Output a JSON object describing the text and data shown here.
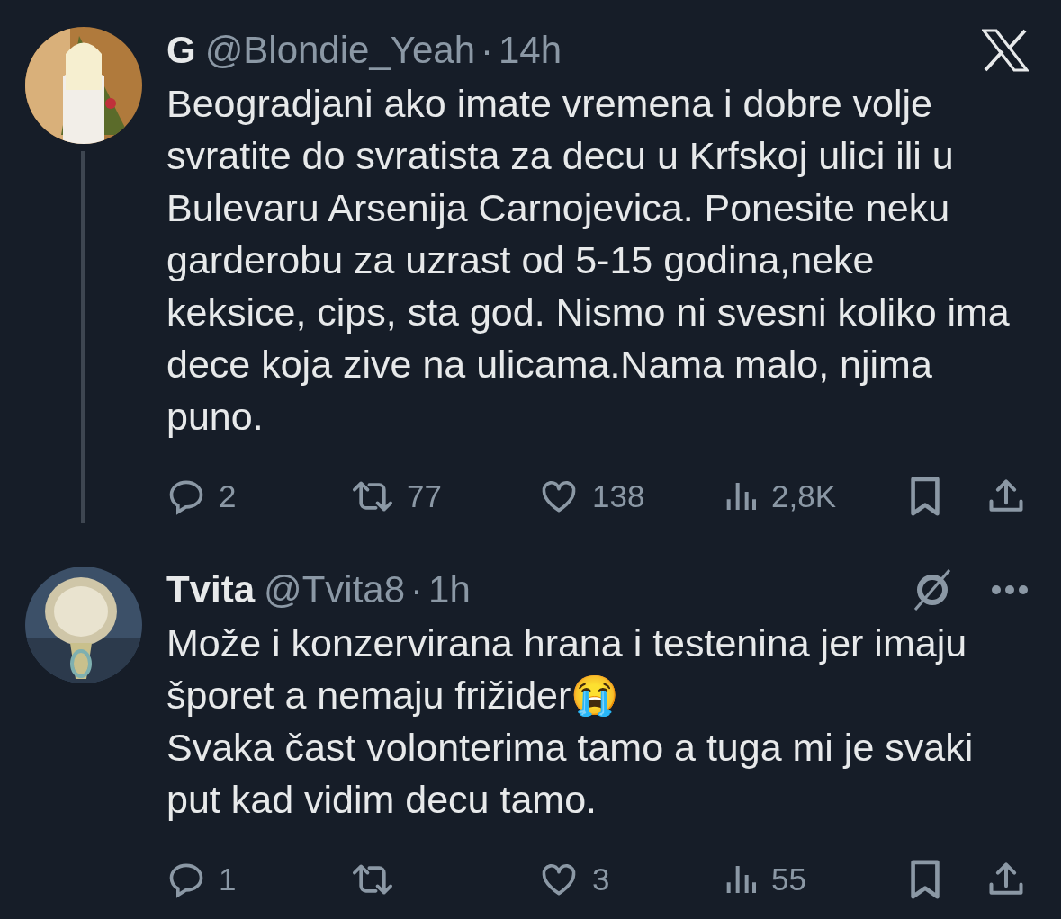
{
  "tweets": [
    {
      "name": "G",
      "handle": "@Blondie_Yeah",
      "separator": "·",
      "time": "14h",
      "x_logo": true,
      "grok_button": false,
      "more_button": false,
      "thread_line": true,
      "text": "Beogradjani ako imate vremena i dobre volje svratite do svratista za decu u Krfskoj ulici ili u Bulevaru Arsenija Carnojevica. Ponesite neku garderobu za uzrast od 5-15 godina,neke keksice, cips, sta god. Nismo ni svesni koliko ima dece koja zive na ulicama.Nama malo, njima puno.",
      "stats": {
        "replies": "2",
        "reposts": "77",
        "likes": "138",
        "views": "2,8K"
      }
    },
    {
      "name": "Tvita",
      "handle": "@Tvita8",
      "separator": "·",
      "time": "1h",
      "x_logo": false,
      "grok_button": true,
      "more_button": true,
      "thread_line": false,
      "text": "Može i konzervirana hrana i testenina jer imaju šporet a nemaju frižider😭\nSvaka čast volonterima tamo a tuga mi je svaki put kad vidim decu tamo.",
      "stats": {
        "replies": "1",
        "likes": "3",
        "views": "55"
      }
    }
  ]
}
